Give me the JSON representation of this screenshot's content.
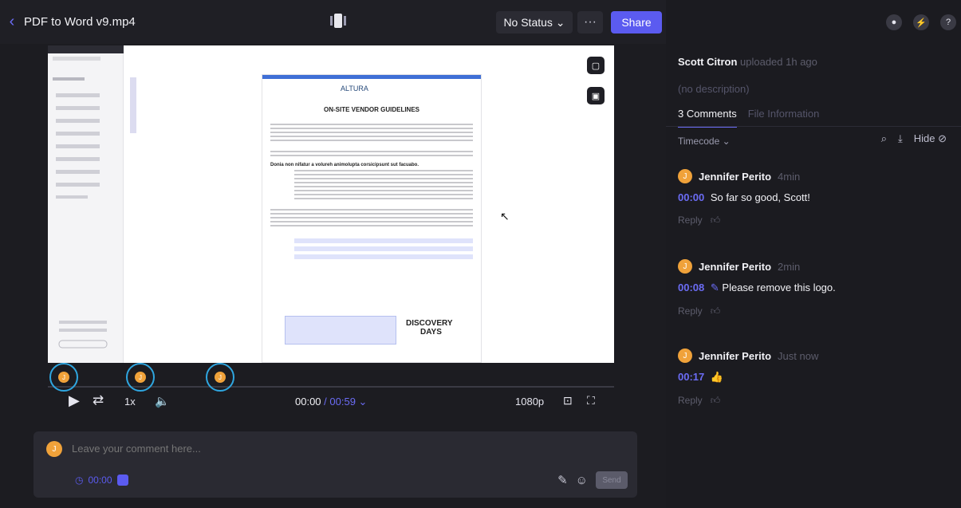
{
  "header": {
    "back_icon": "chevron-left-icon",
    "title": "PDF to Word v9.mp4",
    "status_label": "No Status ⌄",
    "more_label": "···",
    "share_label": "Share"
  },
  "right_panel": {
    "uploader_name": "Scott Citron",
    "uploaded_text": "uploaded 1h ago",
    "description": "(no description)",
    "tabs": [
      {
        "label": "3 Comments"
      },
      {
        "label": "File Information"
      }
    ],
    "timecode_filter": "Timecode ⌄",
    "hide_label": "Hide",
    "comments": [
      {
        "avatar": "J",
        "author": "Jennifer Perito",
        "time": "4min",
        "timecode": "00:00",
        "text": "So far so good, Scott!",
        "reply": "Reply"
      },
      {
        "avatar": "J",
        "author": "Jennifer Perito",
        "time": "2min",
        "timecode": "00:08",
        "text": "Please remove this logo.",
        "reply": "Reply"
      },
      {
        "avatar": "J",
        "author": "Jennifer Perito",
        "time": "Just now",
        "timecode": "00:17",
        "text": "👍",
        "reply": "Reply"
      }
    ]
  },
  "video": {
    "doc_title": "ON-SITE VENDOR GUIDELINES",
    "logo_text": "ALTURA",
    "section_heading": "Donia non nifatur a volureh animolupta corsicipsunt sut facuabo.",
    "sponsor_line1": "DISCOVERY",
    "sponsor_line2": "DAYS"
  },
  "player": {
    "speed": "1x",
    "current_time": "00:00",
    "duration": "/ 00:59 ⌄",
    "quality": "1080p",
    "marker_avatar": "J",
    "markers": [
      {
        "timecode": "00:00"
      },
      {
        "timecode": "00:08"
      },
      {
        "timecode": "00:17"
      }
    ]
  },
  "composer": {
    "avatar": "J",
    "placeholder": "Leave your comment here...",
    "timecode": "00:00",
    "send_label": "Send"
  }
}
